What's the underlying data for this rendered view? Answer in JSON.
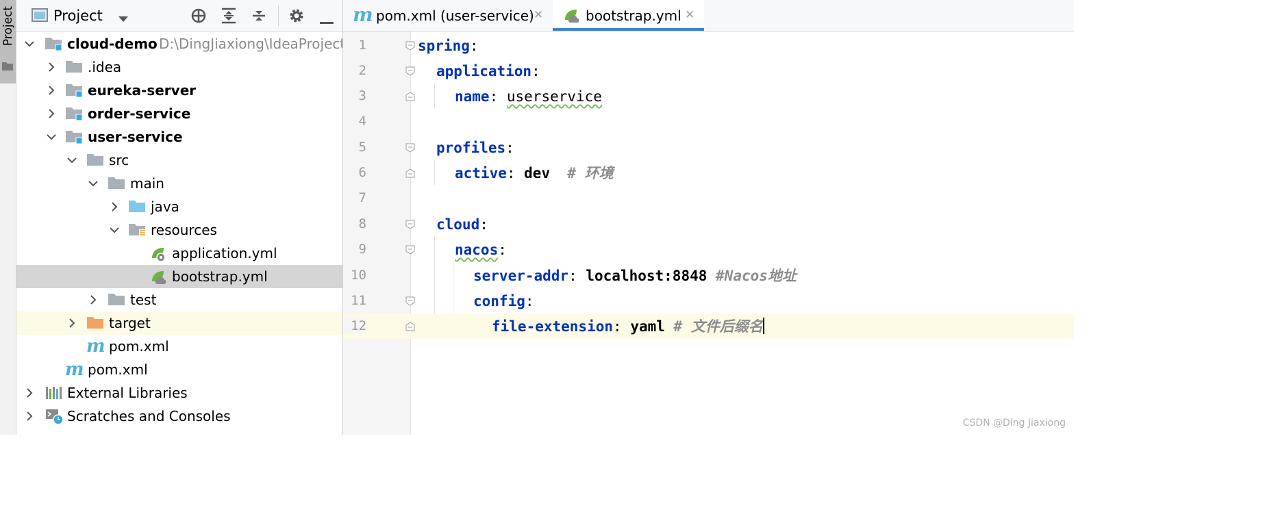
{
  "toolstrip": {
    "tab_label": "Project"
  },
  "project_panel": {
    "title": "Project",
    "tree": [
      {
        "label": "cloud-demo",
        "path": "D:\\DingJiaxiong\\IdeaProject",
        "bold": true
      },
      {
        "label": ".idea",
        "bold": false
      },
      {
        "label": "eureka-server",
        "bold": true
      },
      {
        "label": "order-service",
        "bold": true
      },
      {
        "label": "user-service",
        "bold": true
      },
      {
        "label": "src",
        "bold": false
      },
      {
        "label": "main",
        "bold": false
      },
      {
        "label": "java",
        "bold": false
      },
      {
        "label": "resources",
        "bold": false
      },
      {
        "label": "application.yml",
        "bold": false
      },
      {
        "label": "bootstrap.yml",
        "bold": false
      },
      {
        "label": "test",
        "bold": false
      },
      {
        "label": "target",
        "bold": false
      },
      {
        "label": "pom.xml",
        "bold": false
      },
      {
        "label": "pom.xml",
        "bold": false
      },
      {
        "label": "External Libraries",
        "bold": false
      },
      {
        "label": "Scratches and Consoles",
        "bold": false
      }
    ]
  },
  "editor": {
    "tabs": [
      {
        "label": "pom.xml (user-service)",
        "active": false,
        "close": "✕"
      },
      {
        "label": "bootstrap.yml",
        "active": true,
        "close": "✕"
      }
    ],
    "lines": [
      {
        "num": "1",
        "key": "spring",
        "sep": ":",
        "value": "",
        "comment": ""
      },
      {
        "num": "2",
        "key": "application",
        "sep": ":",
        "value": "",
        "comment": ""
      },
      {
        "num": "3",
        "key": "name",
        "sep": ": ",
        "value": "userservice",
        "comment": ""
      },
      {
        "num": "4",
        "key": "",
        "sep": "",
        "value": "",
        "comment": ""
      },
      {
        "num": "5",
        "key": "profiles",
        "sep": ":",
        "value": "",
        "comment": ""
      },
      {
        "num": "6",
        "key": "active",
        "sep": ": ",
        "value": "dev",
        "comment": "  # 环境"
      },
      {
        "num": "7",
        "key": "",
        "sep": "",
        "value": "",
        "comment": ""
      },
      {
        "num": "8",
        "key": "cloud",
        "sep": ":",
        "value": "",
        "comment": ""
      },
      {
        "num": "9",
        "key": "nacos",
        "sep": ":",
        "value": "",
        "comment": ""
      },
      {
        "num": "10",
        "key": "server-addr",
        "sep": ": ",
        "value": "localhost:8848",
        "comment": " #Nacos地址"
      },
      {
        "num": "11",
        "key": "config",
        "sep": ":",
        "value": "",
        "comment": ""
      },
      {
        "num": "12",
        "key": "file-extension",
        "sep": ": ",
        "value": "yaml",
        "comment": " # 文件后缀名"
      }
    ]
  },
  "watermark": "CSDN @Ding Jiaxiong",
  "colors": {
    "key": "#0033b3",
    "comment": "#8c8c8c",
    "selection": "#d5d5d5",
    "current_line": "#fdfbe6",
    "tab_underline": "#4083c9",
    "folder": "#a9b0b8",
    "module_badge": "#3aa8e0"
  }
}
